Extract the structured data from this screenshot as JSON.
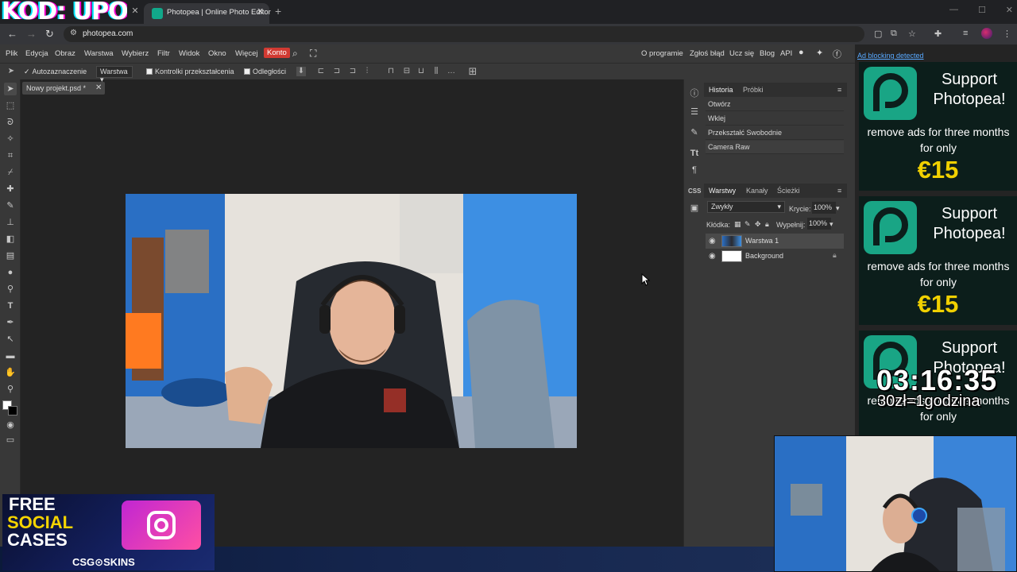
{
  "browser": {
    "overlay_logo": "KOD: UPO",
    "tab_title": "Photopea | Online Photo Editor",
    "url": "photopea.com"
  },
  "menu": {
    "items": [
      "Plik",
      "Edycja",
      "Obraz",
      "Warstwa",
      "Wybierz",
      "Filtr",
      "Widok",
      "Okno",
      "Więcej"
    ],
    "account": "Konto",
    "right_items": [
      "O programie",
      "Zgłoś błąd",
      "Ucz się",
      "Blog",
      "API"
    ]
  },
  "options": {
    "autoselect": "Autozaznaczenie",
    "layer_select": "Warstwa",
    "transform_controls": "Kontrolki przekształcenia",
    "distances": "Odległości"
  },
  "document": {
    "tab_title": "Nowy projekt.psd *"
  },
  "panels": {
    "history_tab": "Historia",
    "samples_tab": "Próbki",
    "history": [
      "Otwórz",
      "Wklej",
      "Przekształć Swobodnie",
      "Camera Raw"
    ],
    "layers_tab": "Warstwy",
    "channels_tab": "Kanały",
    "paths_tab": "Ścieżki",
    "blend_mode": "Zwykły",
    "opacity_label": "Krycie:",
    "opacity_value": "100%",
    "lock_label": "Kłódka:",
    "fill_label": "Wypełnij:",
    "fill_value": "100%",
    "layers": [
      "Warstwa 1",
      "Background"
    ],
    "css_label": "CSS"
  },
  "ad": {
    "header": "Ad blocking detected",
    "support": "Support Photopea!",
    "remove": "remove ads for three months for only",
    "price": "€15"
  },
  "overlays": {
    "timer": "03:16:35",
    "timer_sub": "30zł=1godzina",
    "promo_free": "FREE",
    "promo_social": "SOCIAL",
    "promo_cases": "CASES",
    "promo_brand": "CSG⊙SKINS"
  },
  "colors": {
    "accent": "#d13a32",
    "brand_green": "#19a585",
    "price_yellow": "#f0d000"
  }
}
